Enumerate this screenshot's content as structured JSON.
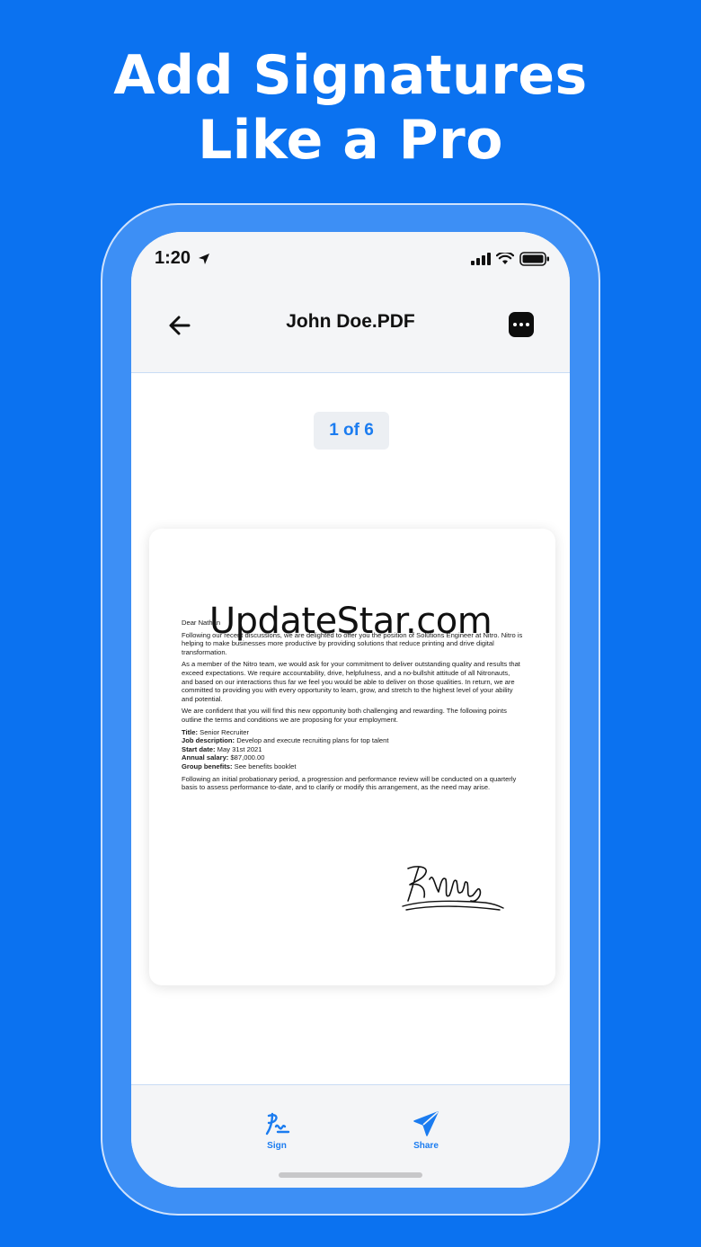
{
  "headline": {
    "line1": "Add Signatures",
    "line2": "Like a Pro"
  },
  "status_bar": {
    "time": "1:20"
  },
  "nav": {
    "title": "John Doe.PDF"
  },
  "page_indicator": "1 of 6",
  "watermark": "UpdateStar.com",
  "letter": {
    "greeting": "Dear Nathan",
    "p1": "Following our recent discussions, we are delighted to offer you the position of Solutions Engineer at Nitro. Nitro is helping to make businesses more productive by providing solutions that reduce printing and drive digital transformation.",
    "p2": "As a member of the Nitro team, we would ask for your commitment to deliver outstanding quality and results that exceed expectations. We require accountability, drive, helpfulness, and a no-bullshit attitude of all Nitronauts, and based on our interactions thus far we feel you would be able to deliver on those qualities. In return, we are committed to providing you with every opportunity to learn, grow, and stretch to the highest level of your ability and potential.",
    "p3": "We are confident that you will find this new opportunity both challenging and rewarding. The following points outline the terms and conditions we are proposing for your employment.",
    "terms": [
      {
        "label": "Title:",
        "value": " Senior Recruiter"
      },
      {
        "label": "Job description:",
        "value": " Develop and execute recruiting plans for top talent"
      },
      {
        "label": "Start date:",
        "value": " May 31st 2021"
      },
      {
        "label": "Annual salary:",
        "value": " $87,000.00"
      },
      {
        "label": "Group benefits:",
        "value": " See benefits booklet"
      }
    ],
    "p4": "Following an initial probationary period, a progression and performance review will be conducted on a quarterly basis to assess performance to-date, and to clarify or modify this arrangement, as the need may arise."
  },
  "tabs": {
    "sign": "Sign",
    "share": "Share"
  },
  "colors": {
    "background": "#0b72f0",
    "accent": "#1b7cf0",
    "phone_frame": "#3d8ff5"
  },
  "icons": [
    "location-arrow-icon",
    "signal-icon",
    "wifi-icon",
    "battery-icon",
    "back-arrow-icon",
    "more-icon",
    "sign-icon",
    "share-icon"
  ]
}
